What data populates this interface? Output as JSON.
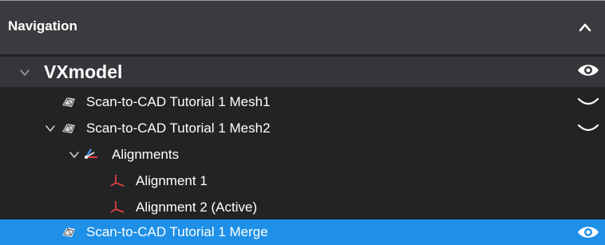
{
  "navigation": {
    "title": "Navigation",
    "collapse_icon": "chevron-up-icon"
  },
  "tree": {
    "root": {
      "label": "VXmodel",
      "expanded": true,
      "visible": true
    },
    "items": [
      {
        "label": "Scan-to-CAD Tutorial 1 Mesh1",
        "icon": "mesh-icon",
        "expanded": false,
        "visibility": "hidden"
      },
      {
        "label": "Scan-to-CAD Tutorial 1 Mesh2",
        "icon": "mesh-icon",
        "expanded": true,
        "visibility": "hidden"
      },
      {
        "label": "Alignments",
        "icon": "alignments-icon",
        "expanded": true
      },
      {
        "label": "Alignment 1",
        "icon": "axis-icon"
      },
      {
        "label": "Alignment 2 (Active)",
        "icon": "axis-icon"
      },
      {
        "label": "Scan-to-CAD Tutorial 1 Merge",
        "icon": "mesh-icon",
        "selected": true,
        "visibility": "visible"
      }
    ]
  },
  "colors": {
    "header_bg": "#3a3b3e",
    "panel_bg": "#222325",
    "root_row_bg": "#34363a",
    "selection_bg": "#1e90e8",
    "text": "#ffffff"
  }
}
